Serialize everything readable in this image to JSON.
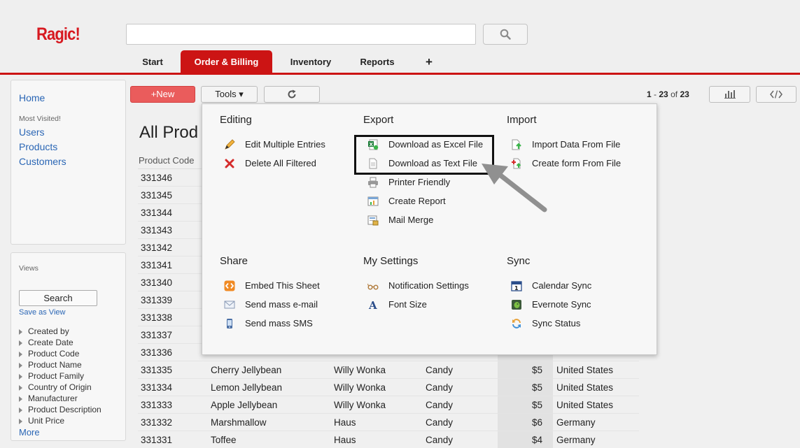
{
  "app": {
    "logo": "Ragic!"
  },
  "header": {
    "search_value": "",
    "tabs": [
      {
        "label": "Start"
      },
      {
        "label": "Order & Billing"
      },
      {
        "label": "Inventory"
      },
      {
        "label": "Reports"
      },
      {
        "label": "+"
      }
    ]
  },
  "sidebar": {
    "home": "Home",
    "most_visited_label": "Most Visited!",
    "links": [
      "Users",
      "Products",
      "Customers"
    ]
  },
  "views_panel": {
    "title": "Views",
    "search_button": "Search",
    "save_as_view": "Save as View",
    "fields": [
      "Created by",
      "Create Date",
      "Product Code",
      "Product Name",
      "Product Family",
      "Country of Origin",
      "Manufacturer",
      "Product Description",
      "Unit Price"
    ],
    "more": "More"
  },
  "toolbar": {
    "new_label": "+New",
    "tools_label": "Tools ▾",
    "pager_start": "1",
    "pager_sep": "-",
    "pager_end": "23",
    "pager_of": "of",
    "pager_total": "23"
  },
  "main": {
    "title": "All Prod",
    "column_header": "Product Code",
    "codes_only": [
      "331346",
      "331345",
      "331344",
      "331343",
      "331342",
      "331341",
      "331340",
      "331339",
      "331338",
      "331337",
      "331336"
    ],
    "rows": [
      {
        "code": "331335",
        "name": "Cherry Jellybean",
        "maker": "Willy Wonka",
        "family": "Candy",
        "price": "$5",
        "country": "United States"
      },
      {
        "code": "331334",
        "name": "Lemon Jellybean",
        "maker": "Willy Wonka",
        "family": "Candy",
        "price": "$5",
        "country": "United States"
      },
      {
        "code": "331333",
        "name": "Apple Jellybean",
        "maker": "Willy Wonka",
        "family": "Candy",
        "price": "$5",
        "country": "United States"
      },
      {
        "code": "331332",
        "name": "Marshmallow",
        "maker": "Haus",
        "family": "Candy",
        "price": "$6",
        "country": "Germany"
      },
      {
        "code": "331331",
        "name": "Toffee",
        "maker": "Haus",
        "family": "Candy",
        "price": "$4",
        "country": "Germany"
      }
    ]
  },
  "tools_menu": {
    "editing": {
      "title": "Editing",
      "items": [
        "Edit Multiple Entries",
        "Delete All Filtered"
      ]
    },
    "export": {
      "title": "Export",
      "items": [
        "Download as Excel File",
        "Download as Text File",
        "Printer Friendly",
        "Create Report",
        "Mail Merge"
      ]
    },
    "import": {
      "title": "Import",
      "items": [
        "Import Data From File",
        "Create form From File"
      ]
    },
    "share": {
      "title": "Share",
      "items": [
        "Embed This Sheet",
        "Send mass e-mail",
        "Send mass SMS"
      ]
    },
    "my_settings": {
      "title": "My Settings",
      "items": [
        "Notification Settings",
        "Font Size"
      ]
    },
    "sync": {
      "title": "Sync",
      "items": [
        "Calendar Sync",
        "Evernote Sync",
        "Sync Status"
      ]
    }
  },
  "colors": {
    "brand_red": "#cc1414",
    "link_blue": "#2a66b5",
    "new_button": "#ea5c5c"
  }
}
